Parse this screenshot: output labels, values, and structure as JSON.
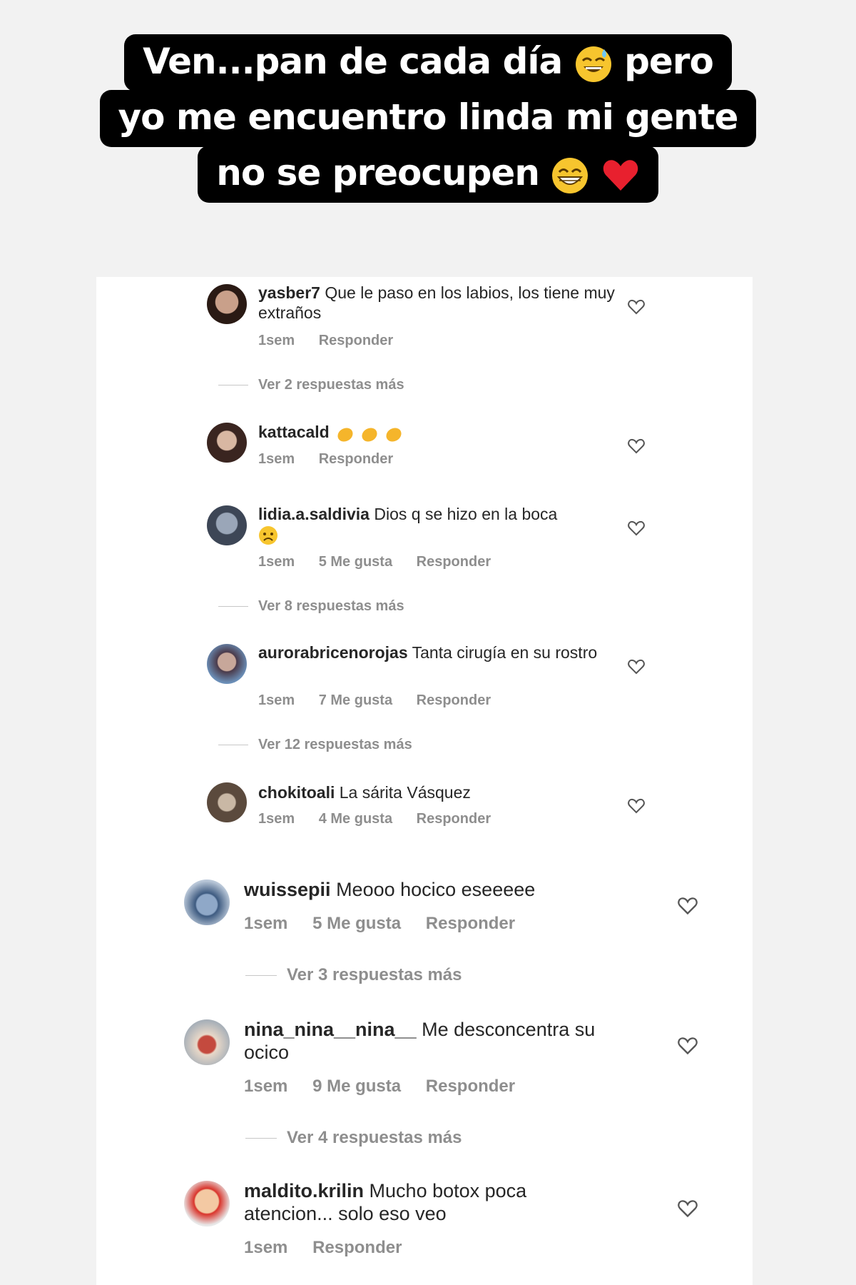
{
  "caption": {
    "line1_a": "Ven...pan de cada día",
    "line1_b": "pero",
    "line2": "yo me encuentro linda mi gente",
    "line3": "no se preocupen",
    "line1_emoji": "sweat-smile-emoji",
    "line3_emojis": [
      "grin-emoji",
      "red-heart-emoji"
    ]
  },
  "colors": {
    "meta": "#8e8e8e",
    "text": "#262626",
    "caption_bg": "#000000"
  },
  "comments": [
    {
      "user": "yasber7",
      "text": "Que le paso en los labios, los tiene muy extraños",
      "time": "1sem",
      "likes": "",
      "reply": "Responder",
      "more": "Ver 2 respuestas más"
    },
    {
      "user": "kattacald",
      "text": "",
      "text_emoji": "clapping-hands-emoji x3",
      "time": "1sem",
      "likes": "",
      "reply": "Responder",
      "more": ""
    },
    {
      "user": "lidia.a.saldivia",
      "text": "Dios q se hizo en la boca",
      "text_emoji": "worried-face-emoji",
      "time": "1sem",
      "likes": "5 Me gusta",
      "reply": "Responder",
      "more": "Ver 8 respuestas más"
    },
    {
      "user": "aurorabricenorojas",
      "text": "Tanta cirugía  en su rostro",
      "time": "1sem",
      "likes": "7 Me gusta",
      "reply": "Responder",
      "more": "Ver 12 respuestas más"
    },
    {
      "user": "chokitoali",
      "text": "La sárita Vásquez",
      "time": "1sem",
      "likes": "4 Me gusta",
      "reply": "Responder",
      "more": ""
    },
    {
      "user": "wuissepii",
      "text": "Meooo hocico eseeeee",
      "time": "1sem",
      "likes": "5 Me gusta",
      "reply": "Responder",
      "more": "Ver 3 respuestas más"
    },
    {
      "user": "nina_nina__nina__",
      "text": "Me desconcentra su ocico",
      "time": "1sem",
      "likes": "9 Me gusta",
      "reply": "Responder",
      "more": "Ver 4 respuestas más"
    },
    {
      "user": "maldito.krilin",
      "text": "Mucho botox poca atencion... solo eso veo",
      "time": "1sem",
      "likes": "",
      "reply": "Responder",
      "more": ""
    }
  ]
}
